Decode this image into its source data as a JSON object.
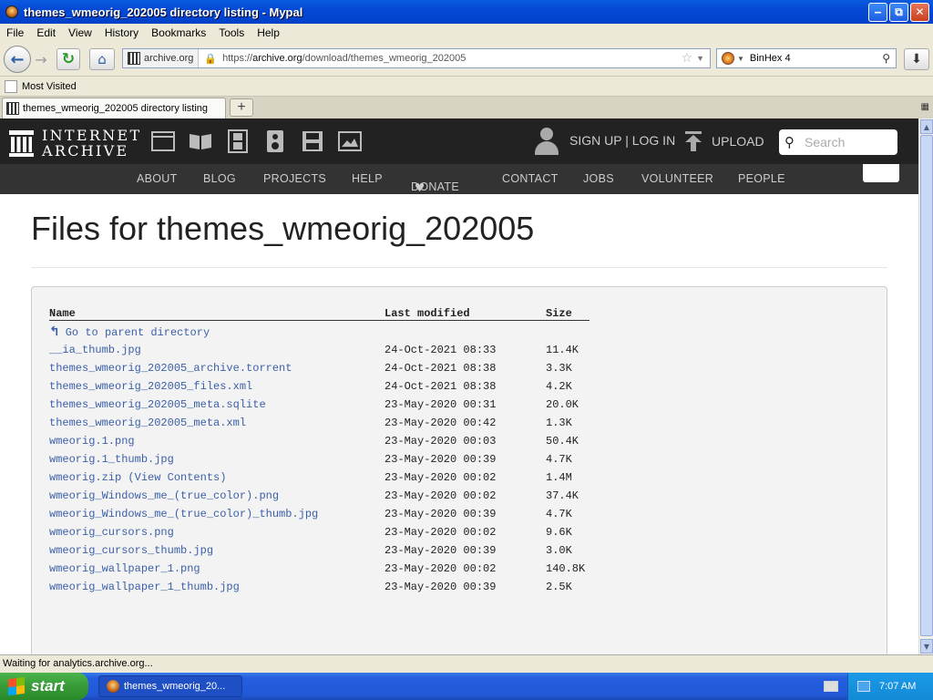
{
  "window": {
    "title": "themes_wmeorig_202005 directory listing - Mypal",
    "min": "‒",
    "max": "⧉",
    "close": "✕"
  },
  "menu": [
    "File",
    "Edit",
    "View",
    "History",
    "Bookmarks",
    "Tools",
    "Help"
  ],
  "nav": {
    "back": "←",
    "forward": "→",
    "reload": "↻",
    "home": "⌂",
    "site_identity": "archive.org",
    "url_prefix": "https://",
    "url_host": "archive.org",
    "url_path": "/download/themes_wmeorig_202005",
    "search_value": "BinHex 4",
    "download": "⬇"
  },
  "bookmarks": {
    "most_visited": "Most Visited"
  },
  "tabs": [
    {
      "label": "themes_wmeorig_202005 directory listing"
    }
  ],
  "ia": {
    "logo_line1": "INTERNET",
    "logo_line2": "ARCHIVE",
    "signup": "SIGN UP | LOG IN",
    "upload": "UPLOAD",
    "search_placeholder": "Search",
    "nav": [
      "ABOUT",
      "BLOG",
      "PROJECTS",
      "HELP",
      "DONATE",
      "CONTACT",
      "JOBS",
      "VOLUNTEER",
      "PEOPLE"
    ]
  },
  "page": {
    "title": "Files for themes_wmeorig_202005",
    "columns": {
      "name": "Name",
      "modified": "Last modified",
      "size": "Size"
    },
    "parent_link": "Go to parent directory",
    "files": [
      {
        "name": "__ia_thumb.jpg",
        "modified": "24-Oct-2021 08:33",
        "size": "11.4K"
      },
      {
        "name": "themes_wmeorig_202005_archive.torrent",
        "modified": "24-Oct-2021 08:38",
        "size": "3.3K"
      },
      {
        "name": "themes_wmeorig_202005_files.xml",
        "modified": "24-Oct-2021 08:38",
        "size": "4.2K"
      },
      {
        "name": "themes_wmeorig_202005_meta.sqlite",
        "modified": "23-May-2020 00:31",
        "size": "20.0K"
      },
      {
        "name": "themes_wmeorig_202005_meta.xml",
        "modified": "23-May-2020 00:42",
        "size": "1.3K"
      },
      {
        "name": "wmeorig.1.png",
        "modified": "23-May-2020 00:03",
        "size": "50.4K"
      },
      {
        "name": "wmeorig.1_thumb.jpg",
        "modified": "23-May-2020 00:39",
        "size": "4.7K"
      },
      {
        "name": "wmeorig.zip",
        "extra": " (View Contents)",
        "modified": "23-May-2020 00:02",
        "size": "1.4M"
      },
      {
        "name": "wmeorig_Windows_me_(true_color).png",
        "modified": "23-May-2020 00:02",
        "size": "37.4K"
      },
      {
        "name": "wmeorig_Windows_me_(true_color)_thumb.jpg",
        "modified": "23-May-2020 00:39",
        "size": "4.7K"
      },
      {
        "name": "wmeorig_cursors.png",
        "modified": "23-May-2020 00:02",
        "size": "9.6K"
      },
      {
        "name": "wmeorig_cursors_thumb.jpg",
        "modified": "23-May-2020 00:39",
        "size": "3.0K"
      },
      {
        "name": "wmeorig_wallpaper_1.png",
        "modified": "23-May-2020 00:02",
        "size": "140.8K"
      },
      {
        "name": "wmeorig_wallpaper_1_thumb.jpg",
        "modified": "23-May-2020 00:39",
        "size": "2.5K"
      }
    ]
  },
  "status": "Waiting for analytics.archive.org...",
  "taskbar": {
    "start": "start",
    "task": "themes_wmeorig_20...",
    "clock": "7:07 AM"
  },
  "colors": {
    "link": "#3a5fa8",
    "ia_bar": "#222222",
    "ia_nav": "#333333",
    "donate_heart": "#e0262d"
  }
}
